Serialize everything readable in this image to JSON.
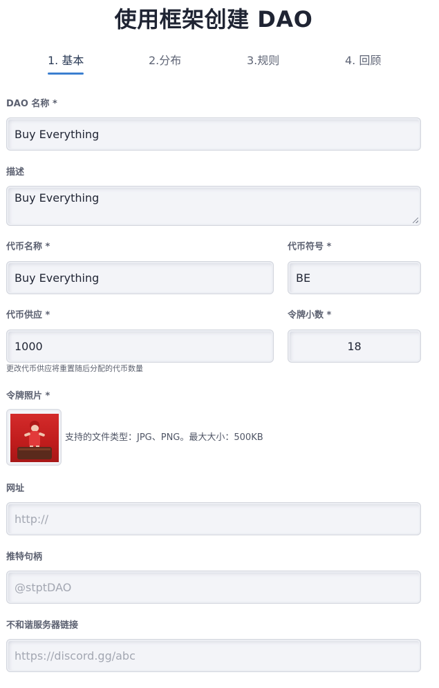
{
  "page": {
    "title": "使用框架创建 DAO"
  },
  "tabs": [
    {
      "label": "1. 基本",
      "active": true
    },
    {
      "label": "2.分布",
      "active": false
    },
    {
      "label": "3.规则",
      "active": false
    },
    {
      "label": "4. 回顾",
      "active": false
    }
  ],
  "form": {
    "dao_name": {
      "label": "DAO 名称 *",
      "value": "Buy Everything"
    },
    "description": {
      "label": "描述",
      "value": "Buy Everything"
    },
    "token_name": {
      "label": "代币名称 *",
      "value": "Buy Everything"
    },
    "token_symbol": {
      "label": "代币符号 *",
      "value": "BE"
    },
    "token_supply": {
      "label": "代币供应 *",
      "value": "1000",
      "hint": "更改代币供应将重置随后分配的代币数量"
    },
    "token_decimals": {
      "label": "令牌小数 *",
      "value": "18"
    },
    "token_photo": {
      "label": "令牌照片 *",
      "support_text": "支持的文件类型：JPG、PNG。最大大小：500KB"
    },
    "website": {
      "label": "网址",
      "value": "",
      "placeholder": "http://"
    },
    "twitter": {
      "label": "推特句柄",
      "value": "",
      "placeholder": "@stptDAO"
    },
    "discord": {
      "label": "不和谐服务器链接",
      "value": "",
      "placeholder": "https://discord.gg/abc"
    }
  },
  "colors": {
    "accent": "#3b7fd0",
    "photo_background": "#c41f1f"
  }
}
